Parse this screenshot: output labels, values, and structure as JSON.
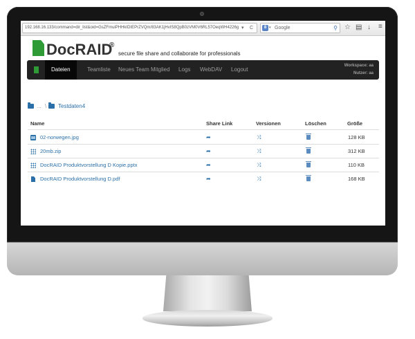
{
  "browser": {
    "url": "192.168.16.133/command=dir_list&oid=GsZFmuiPHHkIDIEPrZVQm/83AK1jHvIS8QpB0zVM0V6RL57OeqWH4226g",
    "reload_glyph": "C",
    "url_dropdown_glyph": "▾",
    "search_placeholder": "Google",
    "search_engine_letter": "8",
    "search_caret": "▾",
    "search_icon": "search-icon",
    "toolbar_icons": [
      "star-icon",
      "clipboard-icon",
      "download-icon",
      "menu-icon"
    ]
  },
  "header": {
    "brand": "DocRAID",
    "registered": "®",
    "tagline": "secure file share and collaborate for professionals"
  },
  "nav": {
    "items": [
      {
        "label": "Dateien",
        "active": true
      },
      {
        "label": "Teamliste",
        "active": false
      },
      {
        "label": "Neues Team Mitglied",
        "active": false
      },
      {
        "label": "Logs",
        "active": false
      },
      {
        "label": "WebDAV",
        "active": false
      },
      {
        "label": "Logout",
        "active": false
      }
    ],
    "workspace": "Workspace: aa",
    "user": "Nutzer: aa"
  },
  "breadcrumb": {
    "ellipsis": "...",
    "separator": "\\",
    "current": "Testdaten4"
  },
  "table": {
    "headers": {
      "name": "Name",
      "share": "Share Link",
      "versions": "Versionen",
      "delete": "Löschen",
      "size": "Größe"
    },
    "rows": [
      {
        "name": "02-norwegen.jpg",
        "size": "128 KB",
        "icon": "image-icon"
      },
      {
        "name": "20mb.zip",
        "size": "312 KB",
        "icon": "archive-icon"
      },
      {
        "name": "DocRAID Produktvorstellung D Kopie.pptx",
        "size": "110 KB",
        "icon": "archive-icon"
      },
      {
        "name": "DocRAID Produktvorstellung D.pdf",
        "size": "168 KB",
        "icon": "file-icon"
      }
    ],
    "share_glyph": "➦",
    "versions_glyph": "⤨"
  },
  "colors": {
    "brand_green": "#2f9b36",
    "navbar": "#222222",
    "link": "#2a6fa8"
  }
}
